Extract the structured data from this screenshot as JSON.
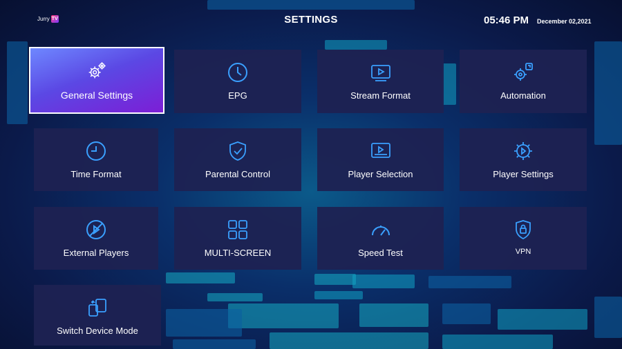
{
  "header": {
    "logo_text": "Jurry",
    "logo_badge": "TV",
    "title": "SETTINGS",
    "time": "05:46 PM",
    "date": "December 02,2021"
  },
  "tiles": [
    {
      "label": "General Settings",
      "icon": "gears-icon",
      "active": true
    },
    {
      "label": "EPG",
      "icon": "clock-icon"
    },
    {
      "label": "Stream Format",
      "icon": "stream-format-icon"
    },
    {
      "label": "Automation",
      "icon": "automation-icon"
    },
    {
      "label": "Time Format",
      "icon": "time-format-icon"
    },
    {
      "label": "Parental Control",
      "icon": "shield-check-icon"
    },
    {
      "label": "Player Selection",
      "icon": "player-selection-icon"
    },
    {
      "label": "Player Settings",
      "icon": "player-settings-icon"
    },
    {
      "label": "External Players",
      "icon": "external-players-icon"
    },
    {
      "label": "MULTI-SCREEN",
      "icon": "multi-screen-icon"
    },
    {
      "label": "Speed Test",
      "icon": "speedometer-icon"
    },
    {
      "label": "VPN",
      "icon": "vpn-icon"
    },
    {
      "label": "Switch Device Mode",
      "icon": "switch-device-icon"
    }
  ],
  "colors": {
    "tile_bg": "#1e2252",
    "active_gradient_start": "#6e88ff",
    "active_gradient_end": "#7c1ed6",
    "icon_color": "#3aa0ff"
  }
}
